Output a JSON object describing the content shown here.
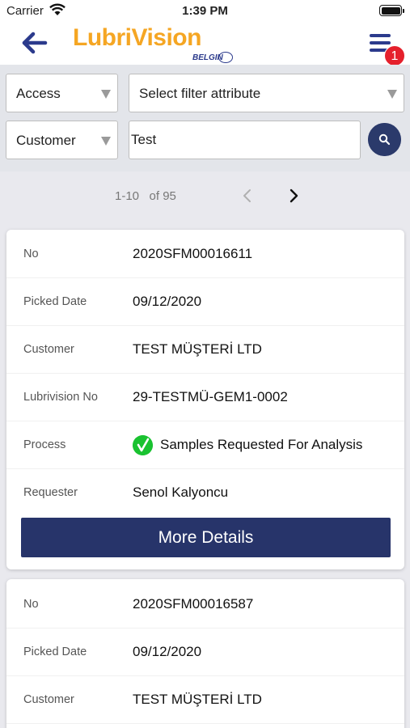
{
  "status_bar": {
    "carrier": "Carrier",
    "time": "1:39 PM"
  },
  "header": {
    "logo_text": "LubriVision",
    "logo_subtext": "BELGIN",
    "notification_count": "1"
  },
  "filters": {
    "type_select": "Access",
    "attribute_select": "Select filter attribute",
    "field_select": "Customer",
    "search_value": "Test"
  },
  "pagination": {
    "range": "1-10   of 95"
  },
  "records": [
    {
      "fields": [
        {
          "label": "No",
          "value": "2020SFM00016611"
        },
        {
          "label": "Picked Date",
          "value": "09/12/2020"
        },
        {
          "label": "Customer",
          "value": "TEST MÜŞTERİ LTD"
        },
        {
          "label": "Lubrivision No",
          "value": "29-TESTMÜ-GEM1-0002"
        },
        {
          "label": "Process",
          "value": "Samples Requested For Analysis"
        },
        {
          "label": "Requester",
          "value": "Senol Kalyoncu"
        }
      ],
      "button_label": "More Details"
    },
    {
      "fields": [
        {
          "label": "No",
          "value": "2020SFM00016587"
        },
        {
          "label": "Picked Date",
          "value": "09/12/2020"
        },
        {
          "label": "Customer",
          "value": "TEST MÜŞTERİ LTD"
        }
      ]
    }
  ],
  "colors": {
    "brand_orange": "#f5a623",
    "brand_navy": "#2b3a8c",
    "button_navy": "#27346a",
    "badge_red": "#e5202c",
    "process_green": "#19c230"
  }
}
